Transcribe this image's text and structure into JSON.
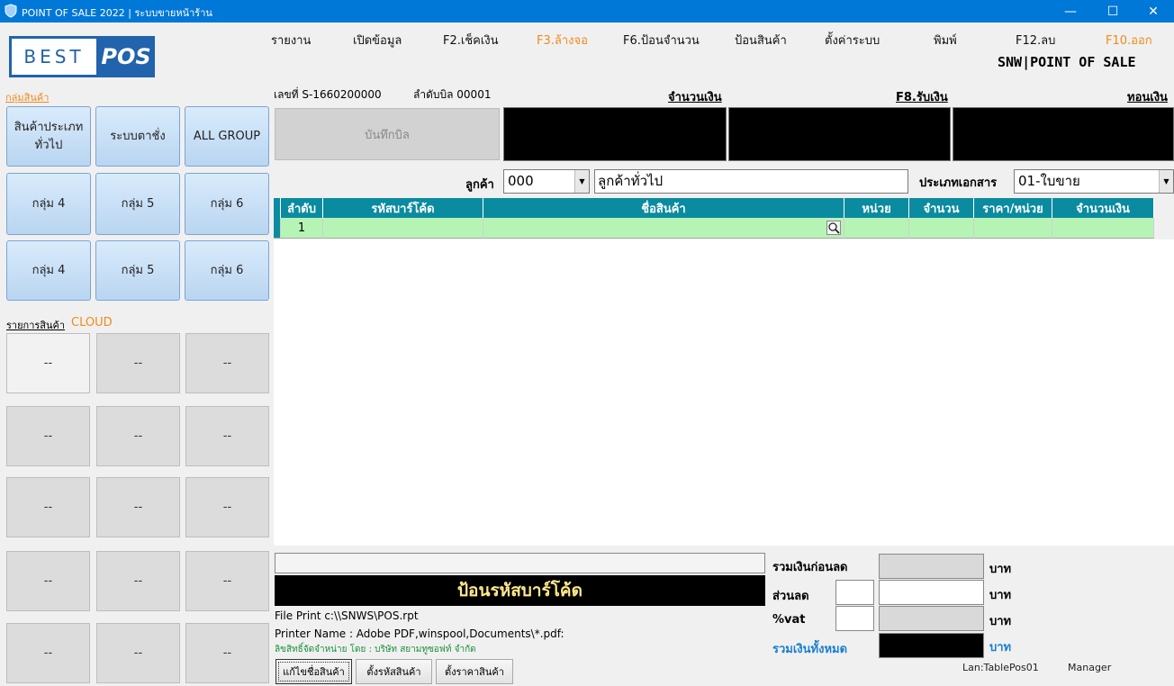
{
  "window": {
    "title": "POINT OF SALE  2022 | ระบบขายหน้าร้าน",
    "minimize_glyph": "—",
    "maximize_glyph": "☐",
    "close_glyph": "✕"
  },
  "logo": {
    "left": "BEST",
    "right": "POS"
  },
  "menu": [
    {
      "label": "รายงาน"
    },
    {
      "label": "เปิดข้อมูล"
    },
    {
      "label": "F2.เช็คเงิน"
    },
    {
      "label": "F3.ล้างจอ"
    },
    {
      "label": "F6.ป้อนจำนวน"
    },
    {
      "label": "ป้อนสินค้า"
    },
    {
      "label": "ตั้งค่าระบบ"
    },
    {
      "label": "พิมพ์"
    },
    {
      "label": "F12.ลบ"
    },
    {
      "label": "F10.ออก"
    }
  ],
  "brand": "SNW|POINT OF SALE",
  "left_panel": {
    "group_label": "กลุ่มสินค้า",
    "groups": [
      "สินค้าประเภท ทั่วไป",
      "ระบบตาชั่ง",
      "ALL GROUP",
      "กลุ่ม 4",
      "กลุ่ม 5",
      "กลุ่ม 6",
      "กลุ่ม 4",
      "กลุ่ม 5",
      "กลุ่ม 6"
    ],
    "items_label": "รายการสินค้า",
    "cloud_label": "CLOUD",
    "product_placeholder": "--"
  },
  "bill": {
    "number_text": "เลขที่ S-1660200000",
    "sequence_text": "ลำดับบิล 00001",
    "save_label": "บันทึกบิล",
    "amount_header": "จำนวนเงิน",
    "receive_header": "F8.รับเงิน",
    "change_header": "ทอนเงิน"
  },
  "customer": {
    "label": "ลูกค้า",
    "code": "000",
    "name": "ลูกค้าทั่วไป",
    "doc_type_label": "ประเภทเอกสาร",
    "doc_type_value": "01-ใบขาย"
  },
  "table": {
    "columns": [
      "ลำดับ",
      "รหัสบาร์โค้ด",
      "ชื่อสินค้า",
      "หน่วย",
      "จำนวน",
      "ราคา/หน่วย",
      "จำนวนเงิน"
    ],
    "rows": [
      {
        "seq": "1",
        "barcode": "",
        "name": "",
        "unit": "",
        "qty": "",
        "price": "",
        "amount": ""
      }
    ]
  },
  "footer": {
    "barcode_prompt": "ป้อนรหัสบาร์โค้ด",
    "file_print": "File Print   c:\\\\SNWS\\POS.rpt",
    "printer_name": "Printer Name :  Adobe PDF,winspool,Documents\\*.pdf:",
    "license": "ลิขสิทธิ์จัดจำหน่าย โดย : บริษัท สยามทูซอฟท์ จำกัด",
    "buttons": [
      "แก้ไขชื่อสินค้า",
      "ตั้งรหัสสินค้า",
      "ตั้งราคาสินค้า"
    ],
    "lan": "Lan:TablePos01",
    "user": "Manager"
  },
  "totals": {
    "before_discount_label": "รวมเงินก่อนลด",
    "discount_label": "ส่วนลด",
    "vat_label": "%vat",
    "grand_total_label": "รวมเงินทั้งหมด",
    "currency": "บาท"
  },
  "colors": {
    "titlebar": "#0078d7",
    "grid_header": "#0a8ba0",
    "grid_row": "#b6f4b6",
    "accent_orange": "#f08a1c",
    "logo_blue": "#2163ac"
  }
}
